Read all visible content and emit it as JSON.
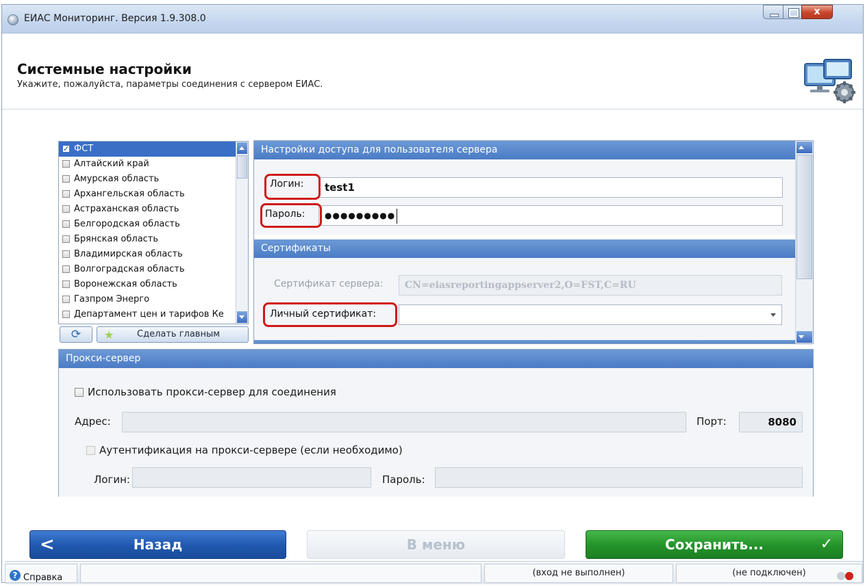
{
  "window": {
    "title": "ЕИАС Мониторинг. Версия 1.9.308.0",
    "close_glyph": "x"
  },
  "header": {
    "title": "Системные настройки",
    "subtitle": "Укажите, пожалуйста, параметры соединения с сервером ЕИАС."
  },
  "regions": {
    "items": [
      {
        "label": "ФСТ",
        "checked": true,
        "selected": true
      },
      {
        "label": "Алтайский край",
        "checked": false
      },
      {
        "label": "Амурская область",
        "checked": false
      },
      {
        "label": "Архангельская область",
        "checked": false
      },
      {
        "label": "Астраханская область",
        "checked": false
      },
      {
        "label": "Белгородская область",
        "checked": false
      },
      {
        "label": "Брянская область",
        "checked": false
      },
      {
        "label": "Владимирская область",
        "checked": false
      },
      {
        "label": "Волгоградская область",
        "checked": false
      },
      {
        "label": "Воронежская область",
        "checked": false
      },
      {
        "label": "Газпром Энерго",
        "checked": false
      },
      {
        "label": "Департамент цен и тарифов Ке",
        "checked": false
      }
    ],
    "make_main_label": "Сделать главным"
  },
  "access": {
    "section_title": "Настройки доступа для пользователя сервера",
    "login_label": "Логин:",
    "login_value": "test1",
    "password_label": "Пароль:",
    "password_value": "●●●●●●●●●"
  },
  "certs": {
    "section_title": "Сертификаты",
    "server_cert_label": "Сертификат сервера:",
    "server_cert_value": "CN=eiasreportingappserver2,O=FST,C=RU",
    "personal_cert_label": "Личный сертификат:",
    "personal_cert_value": ""
  },
  "proxy": {
    "section_title": "Прокси-сервер",
    "use_proxy_label": "Использовать прокси-сервер для соединения",
    "address_label": "Адрес:",
    "address_value": "",
    "port_label": "Порт:",
    "port_value": "8080",
    "auth_label": "Аутентификация на прокси-сервере (если необходимо)",
    "login_label": "Логин:",
    "login_value": "",
    "password_label": "Пароль:",
    "password_value": ""
  },
  "nav": {
    "back_label": "Назад",
    "menu_label": "В меню",
    "save_label": "Сохранить..."
  },
  "status": {
    "help_label": "Справка",
    "login_state": "(вход не выполнен)",
    "connection_state": "(не подключен)"
  },
  "colors": {
    "section_header": "#4a7bc4",
    "back_button": "#1f57ad",
    "save_button": "#23922a",
    "highlight_ring": "#d01818",
    "status_dot_off": "#c9cfd6",
    "status_dot_error": "#d0201a"
  }
}
